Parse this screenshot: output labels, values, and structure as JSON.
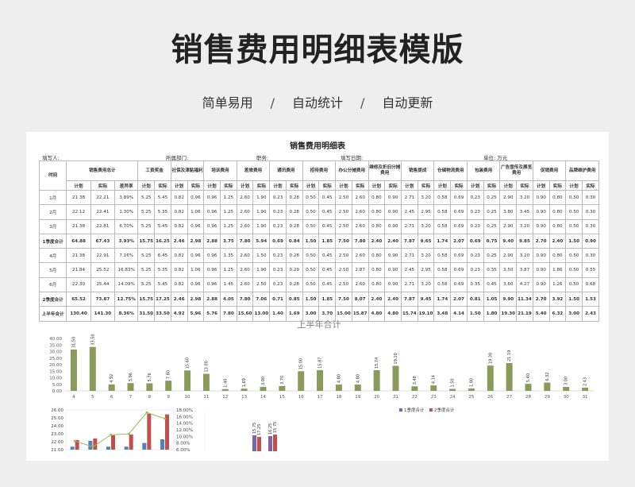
{
  "header": {
    "title": "销售费用明细表模版",
    "tags": [
      "简单易用",
      "自动统计",
      "自动更新"
    ],
    "separator": "/"
  },
  "sheet": {
    "title": "销售费用明细表",
    "info": {
      "filler": "填写人:",
      "dept": "所属部门:",
      "position": "职务:",
      "date": "填写日期:",
      "unit": "单位:  万元"
    },
    "time_header": "时间",
    "group_headers": [
      "销售费用总计",
      "工资奖金",
      "社保及津贴福利",
      "培训费用",
      "差旅费用",
      "通讯费用",
      "招待费用",
      "办公分摊费用",
      "维修及折旧分摊费用",
      "销售提成",
      "仓储物流费用",
      "包装费用",
      "广告宣传及展览费用",
      "促销费用",
      "品牌维护费用"
    ],
    "sub_plan": "计划",
    "sub_actual": "实际",
    "sub_diff": "差异率",
    "rows": [
      {
        "label": "1月",
        "bold": false,
        "cells": [
          "21.38",
          "22.21",
          "3.89%",
          "5.25",
          "5.45",
          "0.82",
          "0.96",
          "0.96",
          "1.25",
          "2.60",
          "1.90",
          "0.23",
          "0.28",
          "0.50",
          "0.45",
          "2.50",
          "2.60",
          "0.80",
          "0.90",
          "2.71",
          "3.20",
          "0.58",
          "0.69",
          "0.23",
          "0.25",
          "2.90",
          "3.20",
          "0.90",
          "0.80",
          "0.50",
          "0.30"
        ]
      },
      {
        "label": "2月",
        "bold": false,
        "cells": [
          "22.12",
          "22.41",
          "1.30%",
          "5.25",
          "5.35",
          "0.82",
          "1.06",
          "0.96",
          "1.25",
          "2.60",
          "1.90",
          "0.23",
          "0.28",
          "0.50",
          "0.45",
          "2.50",
          "2.60",
          "0.80",
          "0.90",
          "2.45",
          "2.95",
          "0.58",
          "0.69",
          "0.23",
          "0.25",
          "3.80",
          "3.45",
          "0.90",
          "0.80",
          "0.50",
          "0.30"
        ]
      },
      {
        "label": "3月",
        "bold": false,
        "cells": [
          "21.38",
          "22.81",
          "6.70%",
          "5.25",
          "5.45",
          "0.82",
          "0.96",
          "0.96",
          "1.25",
          "2.60",
          "1.90",
          "0.23",
          "0.28",
          "0.50",
          "0.45",
          "2.50",
          "2.60",
          "0.80",
          "0.90",
          "2.71",
          "3.20",
          "0.58",
          "0.69",
          "0.23",
          "0.25",
          "2.90",
          "3.20",
          "0.90",
          "0.80",
          "0.50",
          "0.30"
        ]
      },
      {
        "label": "1季度合计",
        "bold": true,
        "cells": [
          "64.88",
          "67.43",
          "3.93%",
          "15.75",
          "16.25",
          "2.46",
          "2.98",
          "2.88",
          "3.75",
          "7.80",
          "5.94",
          "0.69",
          "0.84",
          "1.50",
          "1.85",
          "7.50",
          "7.80",
          "2.40",
          "2.40",
          "7.87",
          "9.65",
          "1.74",
          "2.07",
          "0.69",
          "0.75",
          "9.40",
          "9.85",
          "2.70",
          "2.40",
          "1.50",
          "0.90"
        ]
      },
      {
        "label": "4月",
        "bold": false,
        "cells": [
          "21.38",
          "22.91",
          "7.16%",
          "5.25",
          "6.45",
          "0.82",
          "0.96",
          "0.96",
          "1.35",
          "2.60",
          "1.50",
          "0.23",
          "0.28",
          "0.50",
          "0.45",
          "2.50",
          "2.60",
          "0.80",
          "0.90",
          "2.71",
          "3.20",
          "0.58",
          "0.69",
          "0.23",
          "0.25",
          "2.90",
          "3.20",
          "0.90",
          "0.80",
          "0.50",
          "0.30"
        ]
      },
      {
        "label": "5月",
        "bold": false,
        "cells": [
          "21.84",
          "25.52",
          "16.83%",
          "5.25",
          "5.35",
          "0.82",
          "1.06",
          "0.96",
          "1.25",
          "2.60",
          "1.90",
          "0.23",
          "0.29",
          "0.50",
          "0.45",
          "2.50",
          "2.87",
          "0.80",
          "0.90",
          "2.45",
          "2.95",
          "0.58",
          "0.69",
          "0.23",
          "0.35",
          "3.50",
          "3.87",
          "0.90",
          "1.86",
          "0.50",
          "0.55"
        ]
      },
      {
        "label": "6月",
        "bold": false,
        "cells": [
          "22.30",
          "25.44",
          "14.09%",
          "5.25",
          "5.45",
          "0.82",
          "0.96",
          "0.96",
          "1.45",
          "2.60",
          "2.50",
          "0.23",
          "0.28",
          "0.50",
          "0.45",
          "2.50",
          "2.60",
          "0.80",
          "0.90",
          "2.71",
          "3.20",
          "0.58",
          "0.69",
          "0.35",
          "0.45",
          "3.60",
          "4.27",
          "0.90",
          "1.26",
          "0.50",
          "0.68"
        ]
      },
      {
        "label": "2季度合计",
        "bold": true,
        "cells": [
          "65.52",
          "73.87",
          "12.75%",
          "15.75",
          "17.25",
          "2.46",
          "2.98",
          "2.88",
          "4.05",
          "7.80",
          "7.06",
          "0.71",
          "0.85",
          "1.50",
          "1.85",
          "7.50",
          "8.07",
          "2.40",
          "2.40",
          "7.87",
          "9.45",
          "1.74",
          "2.07",
          "0.81",
          "1.05",
          "9.90",
          "11.34",
          "2.70",
          "3.92",
          "1.50",
          "1.53"
        ]
      },
      {
        "label": "上半年合计",
        "bold": true,
        "cells": [
          "130.40",
          "141.30",
          "8.36%",
          "31.50",
          "33.50",
          "4.92",
          "5.96",
          "5.76",
          "7.80",
          "15.60",
          "13.00",
          "1.40",
          "1.69",
          "3.00",
          "3.70",
          "15.00",
          "15.87",
          "4.80",
          "4.80",
          "15.74",
          "19.10",
          "3.48",
          "4.14",
          "1.50",
          "1.80",
          "19.30",
          "21.19",
          "5.40",
          "6.32",
          "3.00",
          "2.43"
        ]
      }
    ]
  },
  "chart_data": [
    {
      "type": "bar",
      "title": "上半年合计",
      "categories": [
        "4",
        "5",
        "6",
        "7",
        "8",
        "9",
        "10",
        "11",
        "12",
        "13",
        "14",
        "15",
        "16",
        "17",
        "18",
        "19",
        "20",
        "21",
        "22",
        "23",
        "24",
        "25",
        "26",
        "27",
        "28",
        "29",
        "30",
        "31"
      ],
      "values": [
        31.5,
        33.5,
        4.92,
        5.96,
        5.76,
        7.8,
        15.6,
        13.0,
        1.4,
        1.69,
        3.0,
        3.7,
        15.0,
        15.87,
        4.8,
        4.8,
        15.74,
        19.1,
        3.48,
        4.14,
        1.5,
        1.8,
        19.3,
        21.19,
        5.4,
        6.32,
        3.0,
        2.43
      ],
      "ylim": [
        0,
        40
      ],
      "yticks": [
        "0.00",
        "5.00",
        "10.00",
        "15.00",
        "20.00",
        "25.00",
        "30.00",
        "35.00",
        "40.00"
      ],
      "color": "#8a9a5b"
    },
    {
      "type": "bar",
      "yticks_left": [
        "21.00",
        "22.00",
        "23.00",
        "24.00",
        "25.00",
        "26.00"
      ],
      "yticks_right": [
        "6.00%",
        "8.00%",
        "10.00%",
        "12.00%",
        "14.00%",
        "16.00%",
        "18.00%"
      ],
      "series_colors": [
        "#4f81bd",
        "#c0504d"
      ],
      "line_color": "#9bbb59"
    },
    {
      "type": "bar",
      "legend": [
        "1季度合计",
        "2季度合计"
      ],
      "series_colors": [
        "#8064a2",
        "#c0504d"
      ],
      "labels": [
        "15.75",
        "17.25",
        "16.25",
        "15.75"
      ]
    }
  ]
}
